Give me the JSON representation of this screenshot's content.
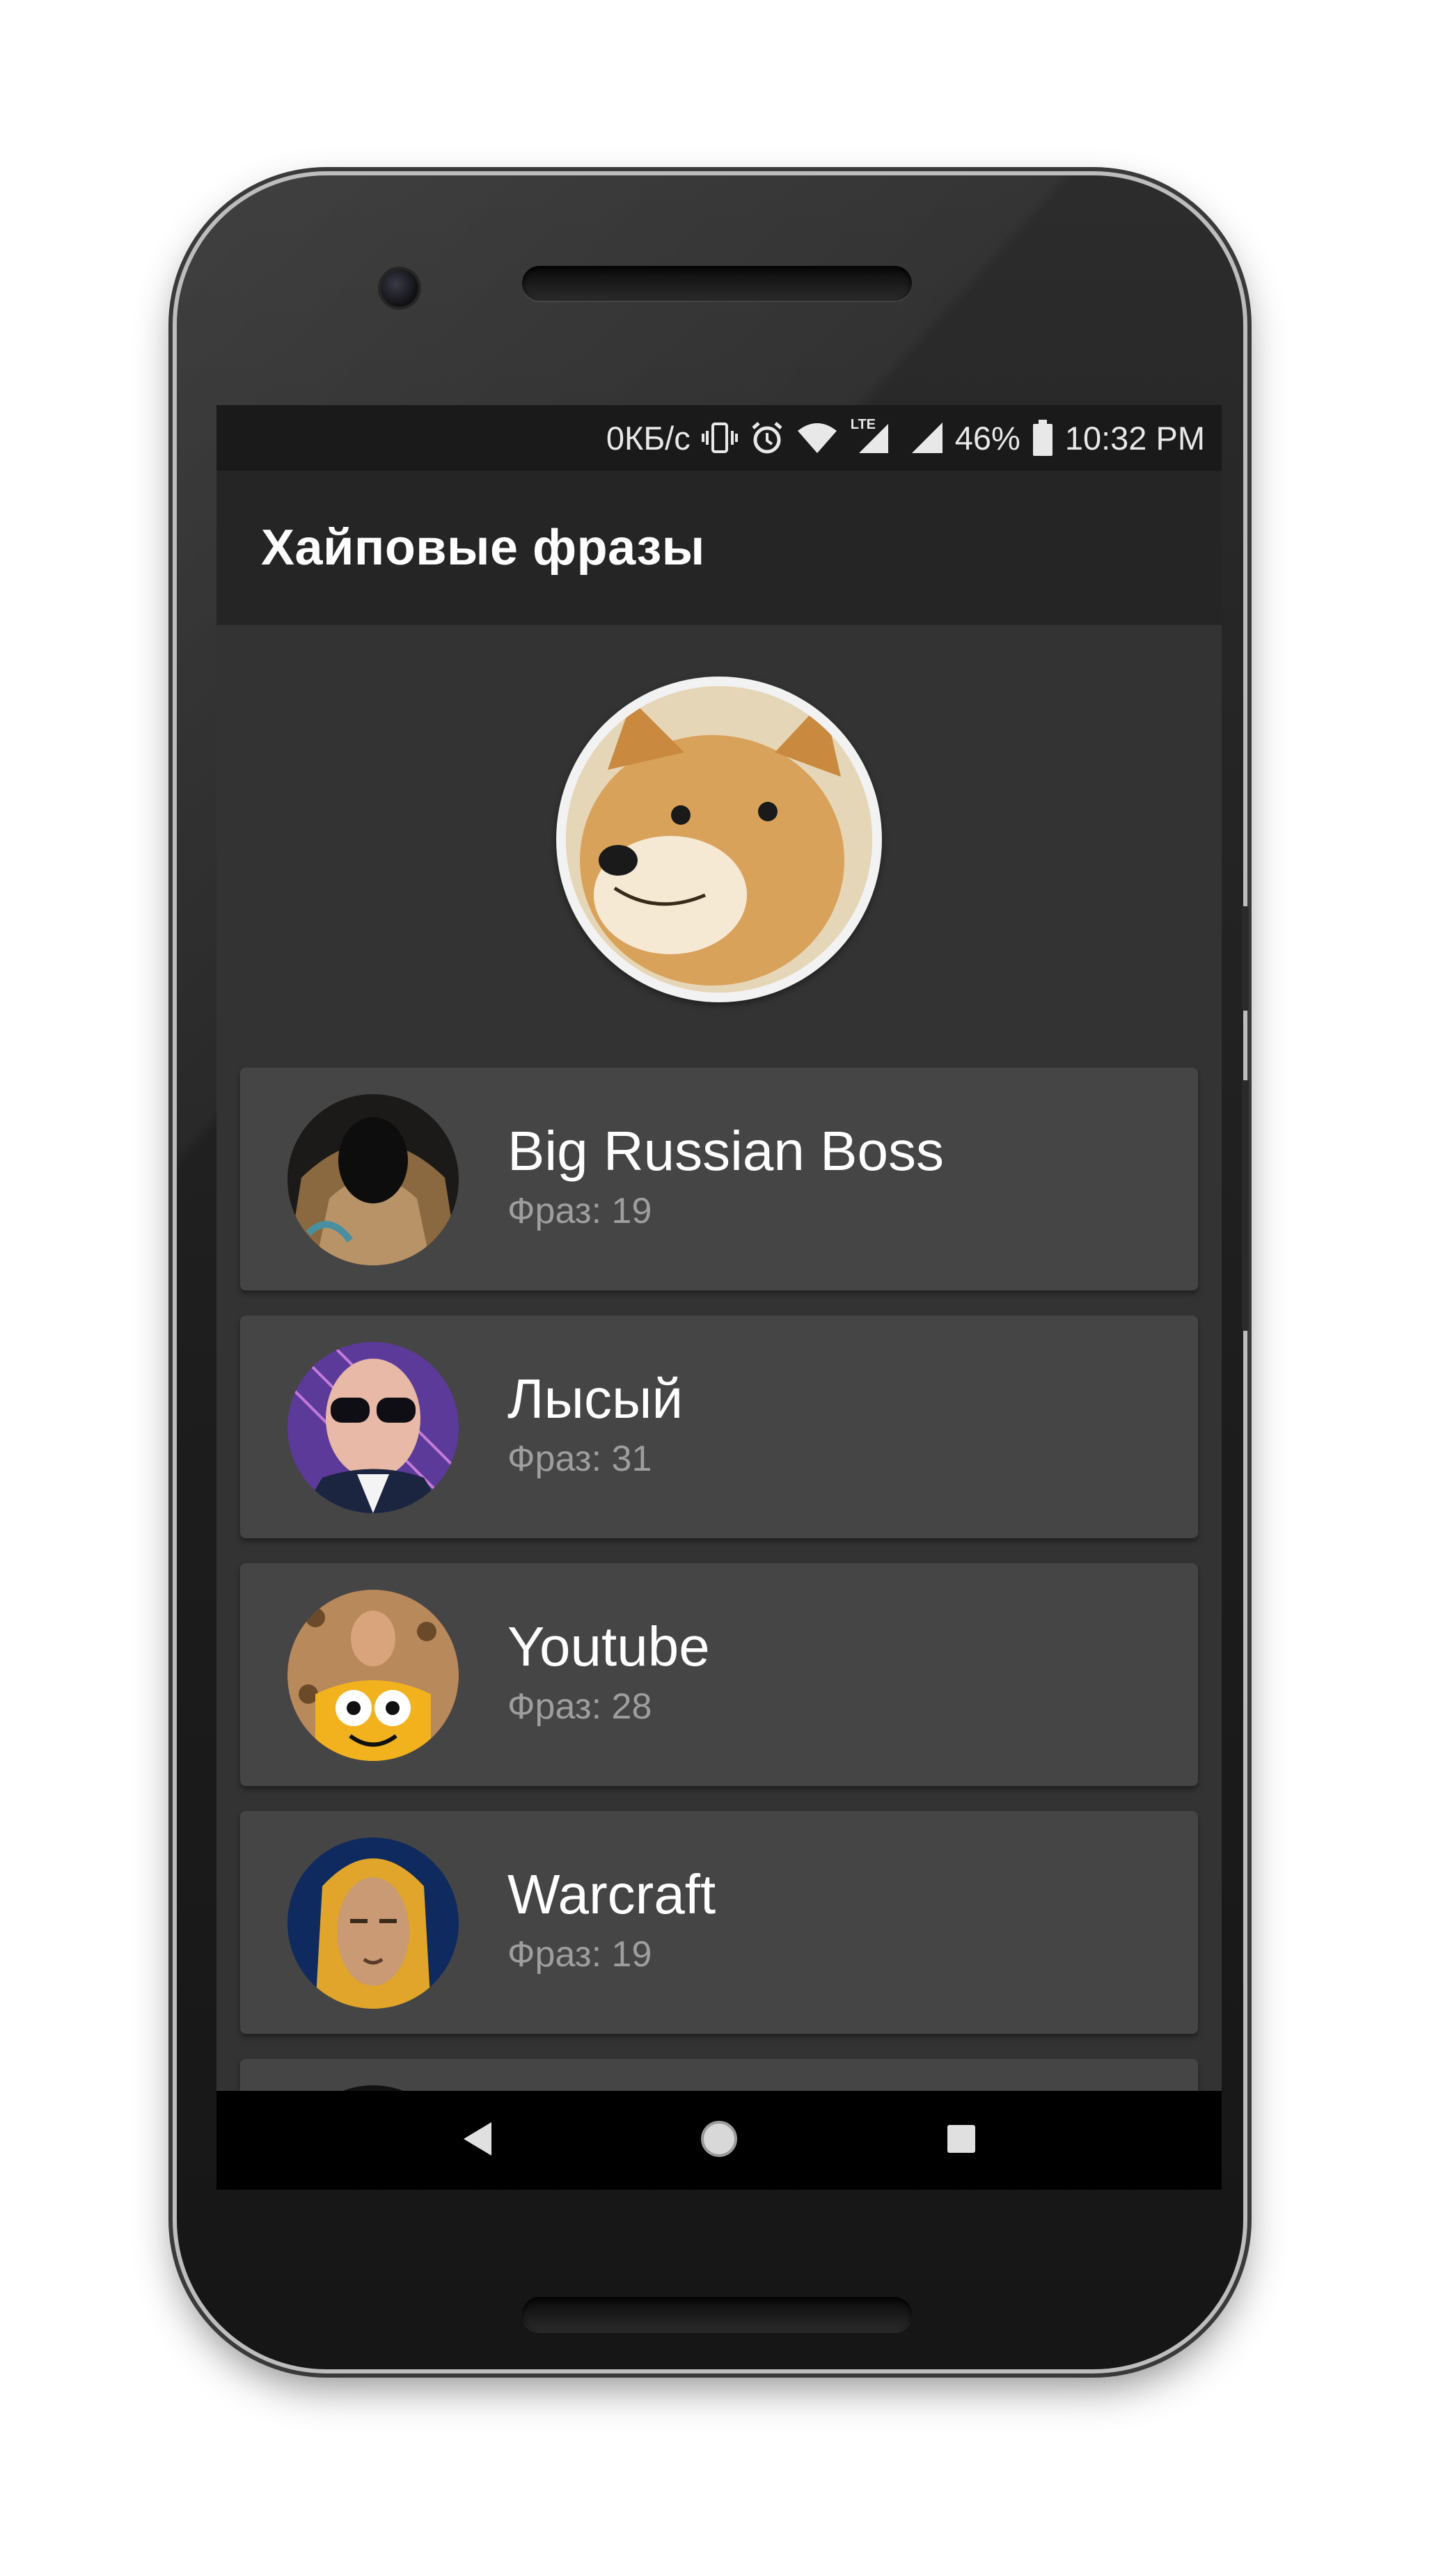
{
  "status_bar": {
    "net_speed": "0КБ/с",
    "lte_label": "LTE",
    "battery_percent": "46%",
    "time": "10:32 PM",
    "icons": [
      "vibrate-icon",
      "alarm-icon",
      "wifi-icon",
      "lte-signal-icon",
      "cell-signal-icon",
      "battery-icon"
    ]
  },
  "app_bar": {
    "title": "Хайповые фразы"
  },
  "hero": {
    "image": "doge-avatar"
  },
  "list": {
    "items": [
      {
        "name": "Big Russian Boss",
        "count": "Фраз: 19",
        "avatar": "big-russian-boss-avatar"
      },
      {
        "name": "Лысый",
        "count": "Фраз: 31",
        "avatar": "lysyi-avatar"
      },
      {
        "name": "Youtube",
        "count": "Фраз: 28",
        "avatar": "youtube-avatar"
      },
      {
        "name": "Warcraft",
        "count": "Фраз: 19",
        "avatar": "warcraft-avatar"
      },
      {
        "name": "",
        "count": "",
        "avatar": "partial-avatar"
      }
    ]
  },
  "nav_bar": {
    "buttons": [
      "back-icon",
      "home-icon",
      "recents-icon"
    ]
  },
  "colors": {
    "screen_bg": "#333333",
    "card_bg": "#454545",
    "app_bar_bg": "#252525",
    "status_bar_bg": "#1a1a1a",
    "secondary_text": "#9e9e9e"
  }
}
